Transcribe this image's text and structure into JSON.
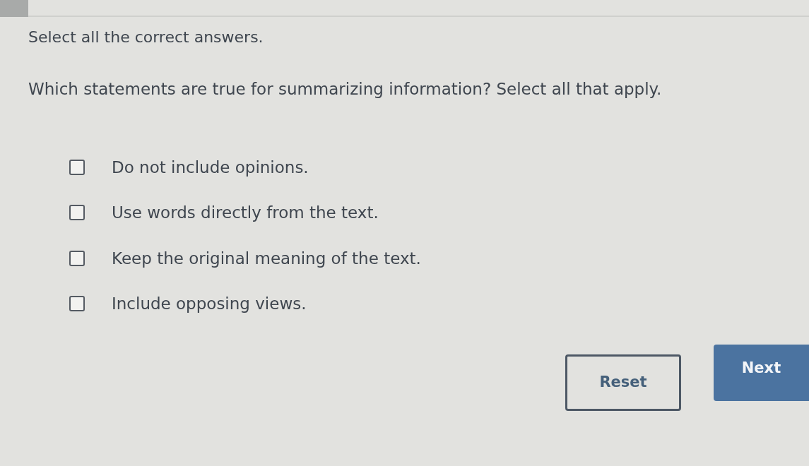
{
  "instruction": "Select all the correct answers.",
  "question": "Which statements are true for summarizing information? Select all that apply.",
  "options": [
    {
      "label": "Do not include opinions.",
      "checked": false
    },
    {
      "label": "Use words directly from the text.",
      "checked": false
    },
    {
      "label": "Keep the original meaning of the text.",
      "checked": false
    },
    {
      "label": "Include opposing views.",
      "checked": false
    }
  ],
  "buttons": [
    {
      "label": "Reset",
      "kind": "outline"
    },
    {
      "label": "Next",
      "kind": "primary"
    }
  ]
}
